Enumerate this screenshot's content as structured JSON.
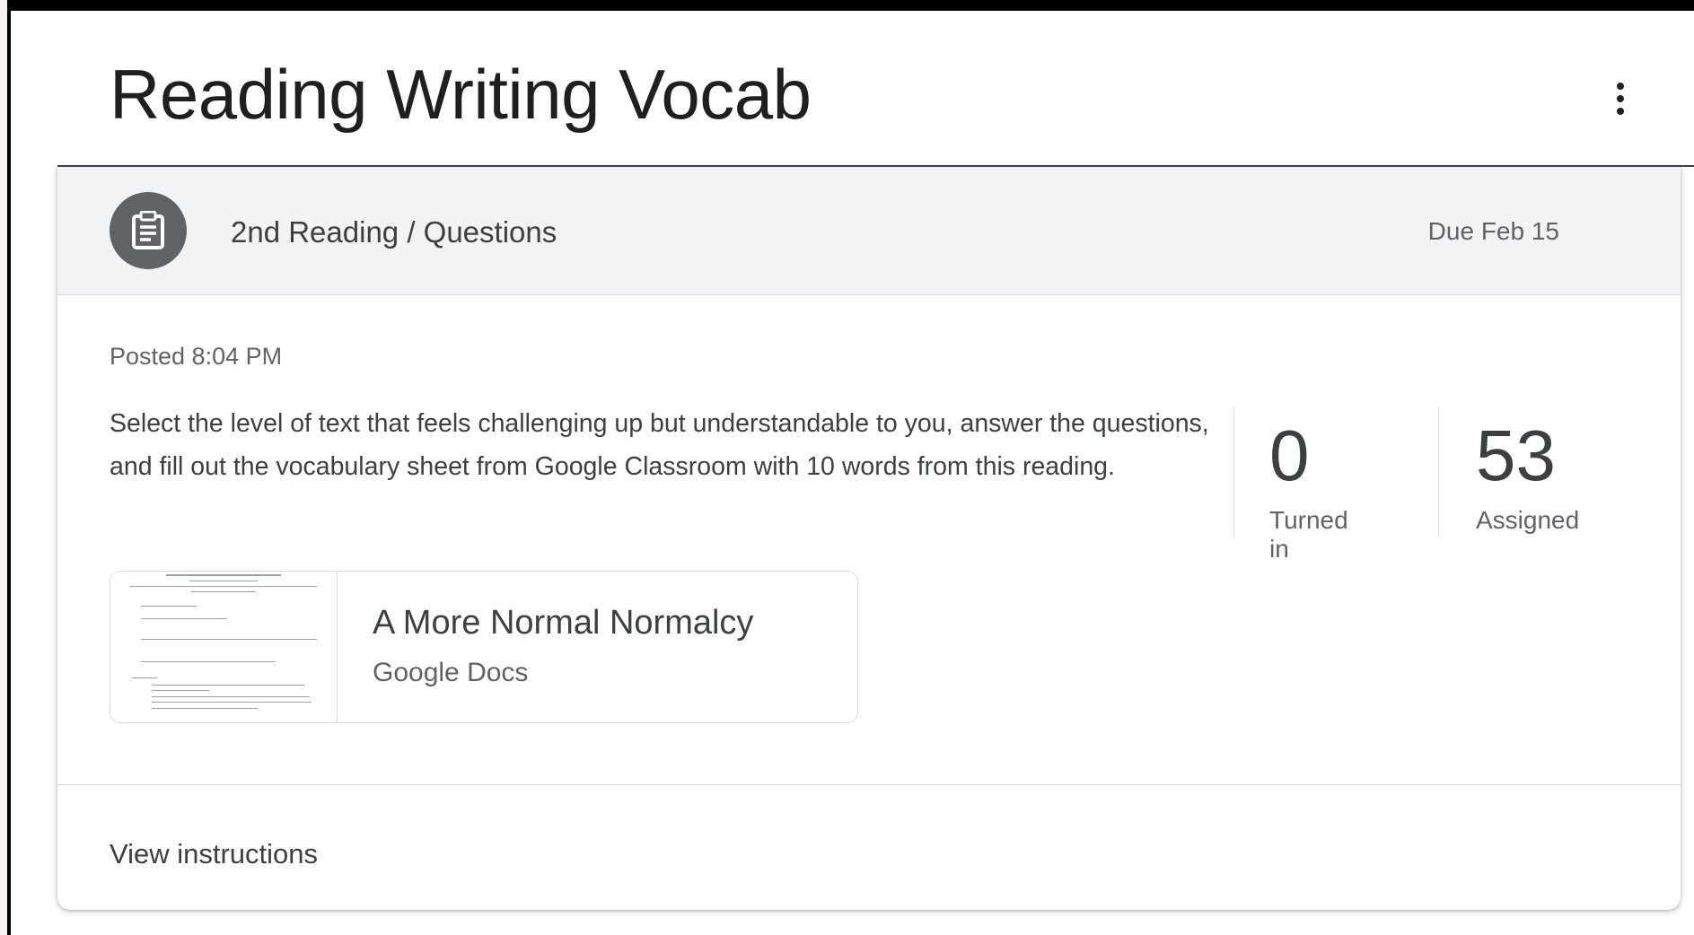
{
  "topic": {
    "title": "Reading Writing Vocab",
    "more_icon": "more-vert-icon"
  },
  "assignment": {
    "icon": "assignment-icon",
    "title": "2nd Reading / Questions",
    "due": "Due Feb 15",
    "posted": "Posted 8:04 PM",
    "description": "Select the level of text that feels challenging up but understandable to you, answer the questions, and fill out the vocabulary sheet from Google Classroom with 10 words from this reading.",
    "stats": [
      {
        "value": "0",
        "label": "Turned in"
      },
      {
        "value": "53",
        "label": "Assigned"
      }
    ],
    "attachment": {
      "title": "A More Normal Normalcy",
      "type": "Google Docs"
    },
    "view_instructions": "View instructions"
  },
  "colors": {
    "header_bg": "#f1f3f4",
    "icon_bg": "#5f6368",
    "text_primary": "#3c4043",
    "text_secondary": "#5f6368",
    "border": "#dadce0"
  }
}
